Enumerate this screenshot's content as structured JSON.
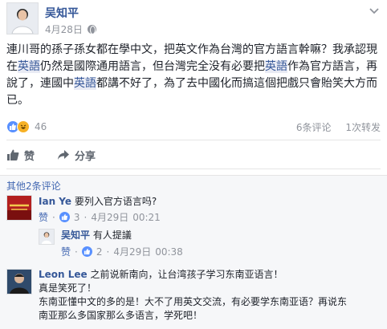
{
  "post": {
    "author": "吴知平",
    "time": "4月28日",
    "text_parts": [
      "連川哥的孫子孫女都在學中文，把英文作為台灣的官方語言幹嘛？我承認現在",
      "英語",
      "仍然是國際通用語言，但台灣完全没有必要把",
      "英語",
      "作為官方語言，再說了，連國中",
      "英語",
      "都講不好了，為了去中國化而搞這個把戲只會貽笑大方而已。"
    ],
    "reaction_count": "46",
    "comment_count": "6条评论",
    "share_count": "1次转发",
    "like_label": "赞",
    "share_label": "分享"
  },
  "comments": {
    "more_label": "其他2条评论",
    "items": [
      {
        "author": "Ian Ye",
        "text": "要列入官方语言吗?",
        "like": "赞",
        "likes": "3",
        "date": "4月29日",
        "time": "00:21"
      },
      {
        "author": "吴知平",
        "text": "有人提議",
        "like": "赞",
        "likes": "2",
        "date": "4月29日",
        "time": "00:38"
      },
      {
        "author": "Leon Lee",
        "lines": [
          "之前说新南向，让台湾孩子学习东南亚语言！",
          "真是笑死了！",
          "东南亚懂中文的多的是！大不了用英文交流，有必要学东南亚语？再说东",
          "南亚那么多国家那么多语言，学死吧！"
        ]
      }
    ]
  },
  "colors": {
    "link": "#365899",
    "accent": "#4267b2",
    "meta": "#90949c",
    "like": "#5890ff",
    "haha": "#f7b125"
  }
}
